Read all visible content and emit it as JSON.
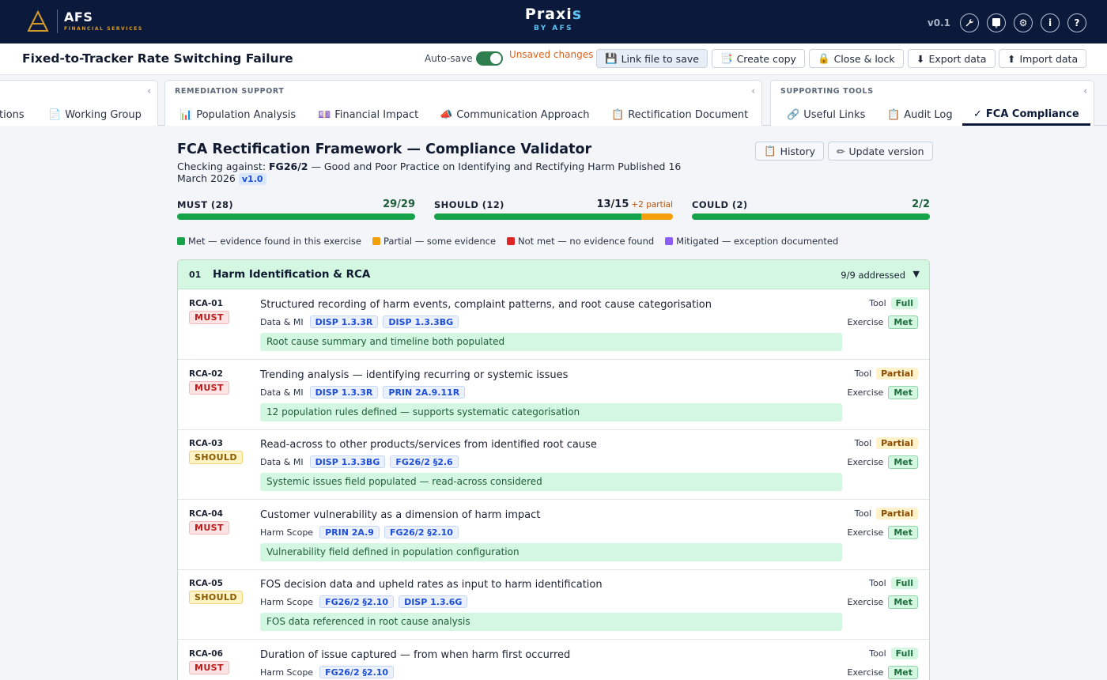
{
  "header": {
    "brand_name": "AFS",
    "brand_sub": "FINANCIAL SERVICES",
    "product_main": "Praxi",
    "product_accent": "s",
    "product_sub": "BY AFS",
    "version": "v0.1",
    "icons": [
      "wrench-icon",
      "clipboard-plus-icon",
      "gear-icon",
      "info-icon",
      "help-icon"
    ],
    "colors": {
      "nav_bg": "#0b1a3a",
      "accent_gold": "#d69a2d",
      "accent_blue": "#5ec3f2"
    }
  },
  "titlebar": {
    "title": "Fixed-to-Tracker Rate Switching Failure",
    "autosave_label": "Auto-save",
    "unsaved": "Unsaved changes",
    "buttons": {
      "link_file": "Link file to save",
      "create_copy": "Create copy",
      "close_lock": "Close & lock",
      "export": "Export data",
      "import": "Import data"
    }
  },
  "tabs": {
    "group1": {
      "tabs": [
        "tions",
        "Working Group"
      ]
    },
    "group2": {
      "label": "REMEDIATION SUPPORT",
      "tabs": [
        "Population Analysis",
        "Financial Impact",
        "Communication Approach",
        "Rectification Document"
      ]
    },
    "group3": {
      "label": "SUPPORTING TOOLS",
      "tabs": [
        "Useful Links",
        "Audit Log",
        "FCA Compliance"
      ]
    }
  },
  "main": {
    "title": "FCA Rectification Framework — Compliance Validator",
    "history_btn": "History",
    "update_btn": "Update version",
    "checking_prefix": "Checking against:",
    "checking_doc": "FG26/2",
    "checking_rest": " — Good and Poor Practice on Identifying and Rectifying Harm  Published 16 March 2026 ",
    "doc_version": "v1.0",
    "progress": [
      {
        "label": "MUST (28)",
        "count": "29/29",
        "met_fraction": 1.0,
        "partial_fraction": 0,
        "partial_text": ""
      },
      {
        "label": "SHOULD (12)",
        "count": "13/15",
        "met_fraction": 0.8667,
        "partial_fraction": 0.1333,
        "partial_text": "+2 partial"
      },
      {
        "label": "COULD (2)",
        "count": "2/2",
        "met_fraction": 1.0,
        "partial_fraction": 0,
        "partial_text": ""
      }
    ],
    "legend": [
      {
        "label": "Met — evidence found in this exercise",
        "color": "#16a34a"
      },
      {
        "label": "Partial — some evidence",
        "color": "#f59e0b"
      },
      {
        "label": "Not met — no evidence found",
        "color": "#dc2626"
      },
      {
        "label": "Mitigated — exception documented",
        "color": "#8b5cf6"
      }
    ],
    "section": {
      "num": "01",
      "title": "Harm Identification & RCA",
      "status": "9/9 addressed",
      "tool_label": "Tool",
      "exercise_label": "Exercise",
      "rows": [
        {
          "id": "RCA-01",
          "level": "MUST",
          "text": "Structured recording of harm events, complaint patterns, and root cause categorisation",
          "category": "Data & MI",
          "refs": [
            "DISP 1.3.3R",
            "DISP 1.3.3BG"
          ],
          "evidence": "Root cause summary and timeline both populated",
          "tool": "Full",
          "exercise": "Met"
        },
        {
          "id": "RCA-02",
          "level": "MUST",
          "text": "Trending analysis — identifying recurring or systemic issues",
          "category": "Data & MI",
          "refs": [
            "DISP 1.3.3R",
            "PRIN 2A.9.11R"
          ],
          "evidence": "12 population rules defined — supports systematic categorisation",
          "tool": "Partial",
          "exercise": "Met"
        },
        {
          "id": "RCA-03",
          "level": "SHOULD",
          "text": "Read-across to other products/services from identified root cause",
          "category": "Data & MI",
          "refs": [
            "DISP 1.3.3BG",
            "FG26/2 §2.6"
          ],
          "evidence": "Systemic issues field populated — read-across considered",
          "tool": "Partial",
          "exercise": "Met"
        },
        {
          "id": "RCA-04",
          "level": "MUST",
          "text": "Customer vulnerability as a dimension of harm impact",
          "category": "Harm Scope",
          "refs": [
            "PRIN 2A.9",
            "FG26/2 §2.10"
          ],
          "evidence": "Vulnerability field defined in population configuration",
          "tool": "Partial",
          "exercise": "Met"
        },
        {
          "id": "RCA-05",
          "level": "SHOULD",
          "text": "FOS decision data and upheld rates as input to harm identification",
          "category": "Harm Scope",
          "refs": [
            "FG26/2 §2.10",
            "DISP 1.3.6G"
          ],
          "evidence": "FOS data referenced in root cause analysis",
          "tool": "Full",
          "exercise": "Met"
        },
        {
          "id": "RCA-06",
          "level": "MUST",
          "text": "Duration of issue captured — from when harm first occurred",
          "category": "Harm Scope",
          "refs": [
            "FG26/2 §2.10"
          ],
          "evidence": "",
          "tool": "Full",
          "exercise": "Met"
        }
      ]
    }
  }
}
